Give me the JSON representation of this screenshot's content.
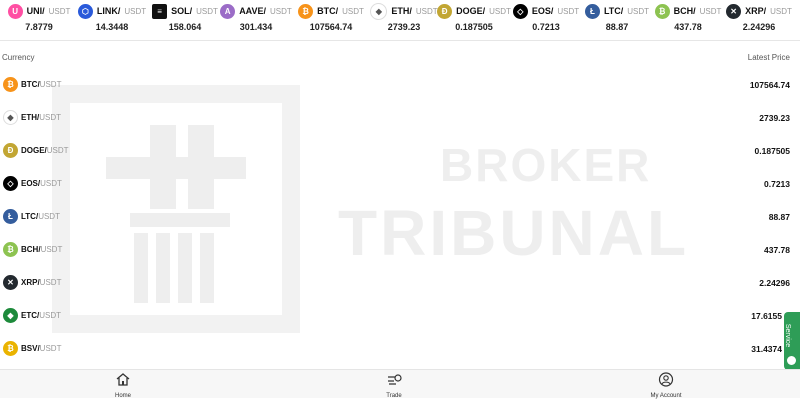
{
  "ticker": [
    {
      "symbol": "UNI/",
      "quote": "USDT",
      "price": "7.8779",
      "icon": "uni-icon",
      "color": "#ff4fa3",
      "glyph": "U"
    },
    {
      "symbol": "LINK/",
      "quote": "USDT",
      "price": "14.3448",
      "icon": "link-icon",
      "color": "#2a5ada",
      "glyph": "⬡"
    },
    {
      "symbol": "SOL/",
      "quote": "USDT",
      "price": "158.064",
      "icon": "sol-icon",
      "color": "#111111",
      "glyph": "≡"
    },
    {
      "symbol": "AAVE/",
      "quote": "USDT",
      "price": "301.434",
      "icon": "aave-icon",
      "color": "#9b6cc7",
      "glyph": "A"
    },
    {
      "symbol": "BTC/",
      "quote": "USDT",
      "price": "107564.74",
      "icon": "btc-icon",
      "color": "#f7931a",
      "glyph": "₿"
    },
    {
      "symbol": "ETH/",
      "quote": "USDT",
      "price": "2739.23",
      "icon": "eth-icon",
      "color": "#6b6b6b",
      "glyph": "◆"
    },
    {
      "symbol": "DOGE/",
      "quote": "USDT",
      "price": "0.187505",
      "icon": "doge-icon",
      "color": "#c2a633",
      "glyph": "Ð"
    },
    {
      "symbol": "EOS/",
      "quote": "USDT",
      "price": "0.7213",
      "icon": "eos-icon",
      "color": "#000000",
      "glyph": "◇"
    },
    {
      "symbol": "LTC/",
      "quote": "USDT",
      "price": "88.87",
      "icon": "ltc-icon",
      "color": "#345d9d",
      "glyph": "Ł"
    },
    {
      "symbol": "BCH/",
      "quote": "USDT",
      "price": "437.78",
      "icon": "bch-icon",
      "color": "#8dc351",
      "glyph": "₿"
    },
    {
      "symbol": "XRP/",
      "quote": "USDT",
      "price": "2.24296",
      "icon": "xrp-icon",
      "color": "#23292f",
      "glyph": "✕"
    }
  ],
  "table": {
    "col_currency": "Currency",
    "col_price": "Latest Price",
    "rows": [
      {
        "symbol": "BTC/",
        "quote": "USDT",
        "price": "107564.74",
        "icon": "btc-icon",
        "color": "#f7931a",
        "glyph": "₿"
      },
      {
        "symbol": "ETH/",
        "quote": "USDT",
        "price": "2739.23",
        "icon": "eth-icon",
        "color": "#6b6b6b",
        "glyph": "◆"
      },
      {
        "symbol": "DOGE/",
        "quote": "USDT",
        "price": "0.187505",
        "icon": "doge-icon",
        "color": "#c2a633",
        "glyph": "Ð"
      },
      {
        "symbol": "EOS/",
        "quote": "USDT",
        "price": "0.7213",
        "icon": "eos-icon",
        "color": "#000000",
        "glyph": "◇"
      },
      {
        "symbol": "LTC/",
        "quote": "USDT",
        "price": "88.87",
        "icon": "ltc-icon",
        "color": "#345d9d",
        "glyph": "Ł"
      },
      {
        "symbol": "BCH/",
        "quote": "USDT",
        "price": "437.78",
        "icon": "bch-icon",
        "color": "#8dc351",
        "glyph": "₿"
      },
      {
        "symbol": "XRP/",
        "quote": "USDT",
        "price": "2.24296",
        "icon": "xrp-icon",
        "color": "#23292f",
        "glyph": "✕"
      },
      {
        "symbol": "ETC/",
        "quote": "USDT",
        "price": "17.6155",
        "icon": "etc-icon",
        "color": "#1d8a3b",
        "glyph": "◆"
      },
      {
        "symbol": "BSV/",
        "quote": "USDT",
        "price": "31.4374",
        "icon": "bsv-icon",
        "color": "#eab300",
        "glyph": "₿"
      }
    ]
  },
  "watermark": {
    "line1": "BROKER",
    "line2": "TRIBUNAL"
  },
  "service_label": "Service",
  "nav": {
    "home": "Home",
    "trade": "Trade",
    "account": "My Account"
  }
}
